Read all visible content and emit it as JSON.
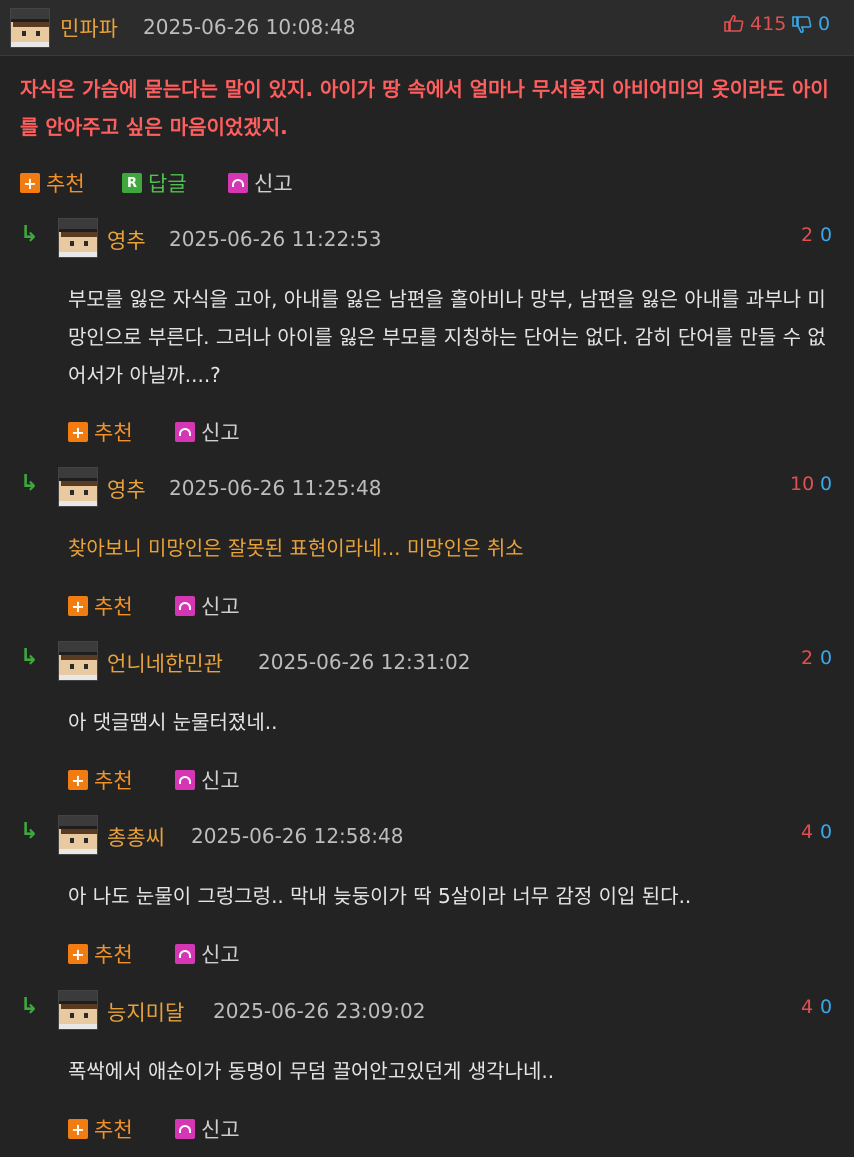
{
  "post": {
    "username": "민파파",
    "timestamp": "2025-06-26 10:08:48",
    "upvotes": "415",
    "downvotes": "0",
    "text": "자식은 가슴에 묻는다는 말이 있지. 아이가 땅 속에서 얼마나 무서울지 아비어미의 옷이라도 아이를 안아주고 싶은 마음이었겠지.",
    "recommend_label": "추천",
    "reply_label": "답글",
    "report_label": "신고",
    "reply_icon_letter": "R"
  },
  "comments": [
    {
      "username": "영추",
      "timestamp": "2025-06-26 11:22:53",
      "up": "2",
      "down": "0",
      "text": "부모를 잃은 자식을 고아, 아내를 잃은 남편을 홀아비나 망부, 남편을 잃은 아내를 과부나 미망인으로 부른다. 그러나 아이를 잃은 부모를 지칭하는 단어는 없다. 감히 단어를 만들 수 없어서가 아닐까....?",
      "recommend_label": "추천",
      "report_label": "신고"
    },
    {
      "username": "영추",
      "timestamp": "2025-06-26 11:25:48",
      "up": "10",
      "down": "0",
      "text": "찾아보니 미망인은 잘못된 표현이라네... 미망인은 취소",
      "recommend_label": "추천",
      "report_label": "신고"
    },
    {
      "username": "언니네한민관",
      "timestamp": "2025-06-26 12:31:02",
      "up": "2",
      "down": "0",
      "text": "아 댓글땜시 눈물터졌네..",
      "recommend_label": "추천",
      "report_label": "신고"
    },
    {
      "username": "총총씨",
      "timestamp": "2025-06-26 12:58:48",
      "up": "4",
      "down": "0",
      "text": "아 나도 눈물이 그렁그렁.. 막내 늦둥이가 딱 5살이라 너무 감정 이입 된다..",
      "recommend_label": "추천",
      "report_label": "신고"
    },
    {
      "username": "능지미달",
      "timestamp": "2025-06-26 23:09:02",
      "up": "4",
      "down": "0",
      "text": "폭싹에서 애순이가 동명이 무덤 끌어안고있던게 생각나네..",
      "recommend_label": "추천",
      "report_label": "신고"
    }
  ],
  "icons": {
    "reply_arrow": "reply-arrow-icon",
    "thumbs_up": "thumbs-up-icon",
    "thumbs_down": "thumbs-down-icon",
    "recommend": "plus-icon",
    "report": "siren-icon"
  },
  "colors": {
    "background": "#232323",
    "username": "#e8a23a",
    "highlight_text": "#ff5e5e",
    "upvote": "#e05050",
    "downvote": "#3aa7e8"
  }
}
